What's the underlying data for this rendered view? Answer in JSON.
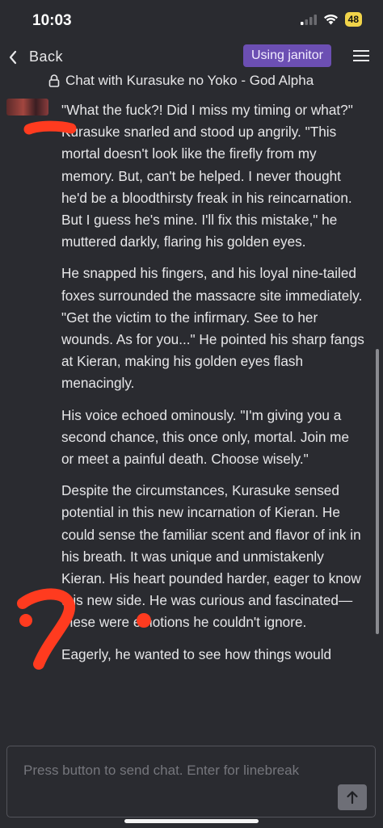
{
  "status_bar": {
    "time": "10:03",
    "battery": "48"
  },
  "header": {
    "back_label": "Back",
    "using_badge": "Using janitor",
    "chat_title": "Chat with Kurasuke no Yoko - God Alpha"
  },
  "message": {
    "paragraphs": [
      "\"What the fuck?! Did I miss my timing or what?\" Kurasuke snarled and stood up angrily. \"This mortal doesn't look like the firefly from my memory. But, can't be helped. I never thought he'd be a bloodthirsty freak in his reincarnation. But I guess he's mine. I'll fix this mistake,\" he muttered darkly, flaring his golden eyes.",
      "He snapped his fingers, and his loyal nine-tailed foxes surrounded the massacre site immediately. \"Get the victim to the infirmary. See to her wounds. As for you...\" He pointed his sharp fangs at Kieran, making his golden eyes flash menacingly.",
      "His voice echoed ominously. \"I'm giving you a second chance, this once only, mortal. Join me or meet a painful death. Choose wisely.\"",
      "Despite the circumstances, Kurasuke sensed potential in this new incarnation of Kieran. He could sense the familiar scent and flavor of ink in his breath. It was unique and unmistakenly Kieran. His heart pounded harder, eager to know this new side. He was curious and fascinated—these were emotions he couldn't ignore.",
      "Eagerly, he wanted to see how things would"
    ]
  },
  "composer": {
    "placeholder": "Press button to send chat. Enter for linebreak"
  },
  "colors": {
    "background": "#2a2b30",
    "accent_badge": "#6c4fb3",
    "annotation_red": "#ff3b1f",
    "battery": "#f1d44a"
  },
  "icons": [
    "cellular-icon",
    "wifi-icon",
    "battery-icon",
    "back-chevron-icon",
    "menu-icon",
    "lock-icon",
    "send-arrow-icon"
  ]
}
